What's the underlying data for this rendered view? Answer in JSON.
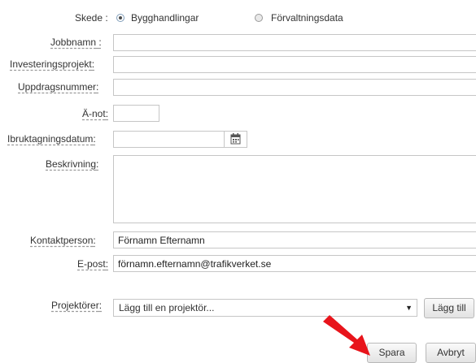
{
  "form": {
    "skede": {
      "label": "Skede",
      "colon": ":",
      "options": [
        "Bygghandlingar",
        "Förvaltningsdata"
      ],
      "selected": "Bygghandlingar"
    },
    "jobbnamn": {
      "label": "Jobbnamn",
      "colon": ":",
      "value": ""
    },
    "investeringsprojekt": {
      "label": "Investeringsprojekt",
      "colon": ":",
      "value": ""
    },
    "uppdragsnummer": {
      "label": "Uppdragsnummer",
      "colon": ":",
      "value": ""
    },
    "a_not": {
      "label": "Ä-not",
      "colon": ":",
      "value": ""
    },
    "ibruktagningsdatum": {
      "label": "Ibruktagningsdatum",
      "colon": ":",
      "value": "",
      "icon": "calendar-icon"
    },
    "beskrivning": {
      "label": "Beskrivning",
      "colon": ":",
      "value": ""
    },
    "kontaktperson": {
      "label": "Kontaktperson",
      "colon": ":",
      "value": "Förnamn Efternamn"
    },
    "epost": {
      "label": "E-post",
      "colon": ":",
      "value": "förnamn.efternamn@trafikverket.se"
    },
    "projektorer": {
      "label": "Projektörer",
      "colon": ":",
      "selected": "Lägg till en projektör...",
      "add_button": "Lägg till"
    }
  },
  "actions": {
    "save": "Spara",
    "cancel": "Avbryt"
  },
  "annotation": {
    "arrow_color": "#e8141b",
    "icon": "arrow-icon"
  }
}
